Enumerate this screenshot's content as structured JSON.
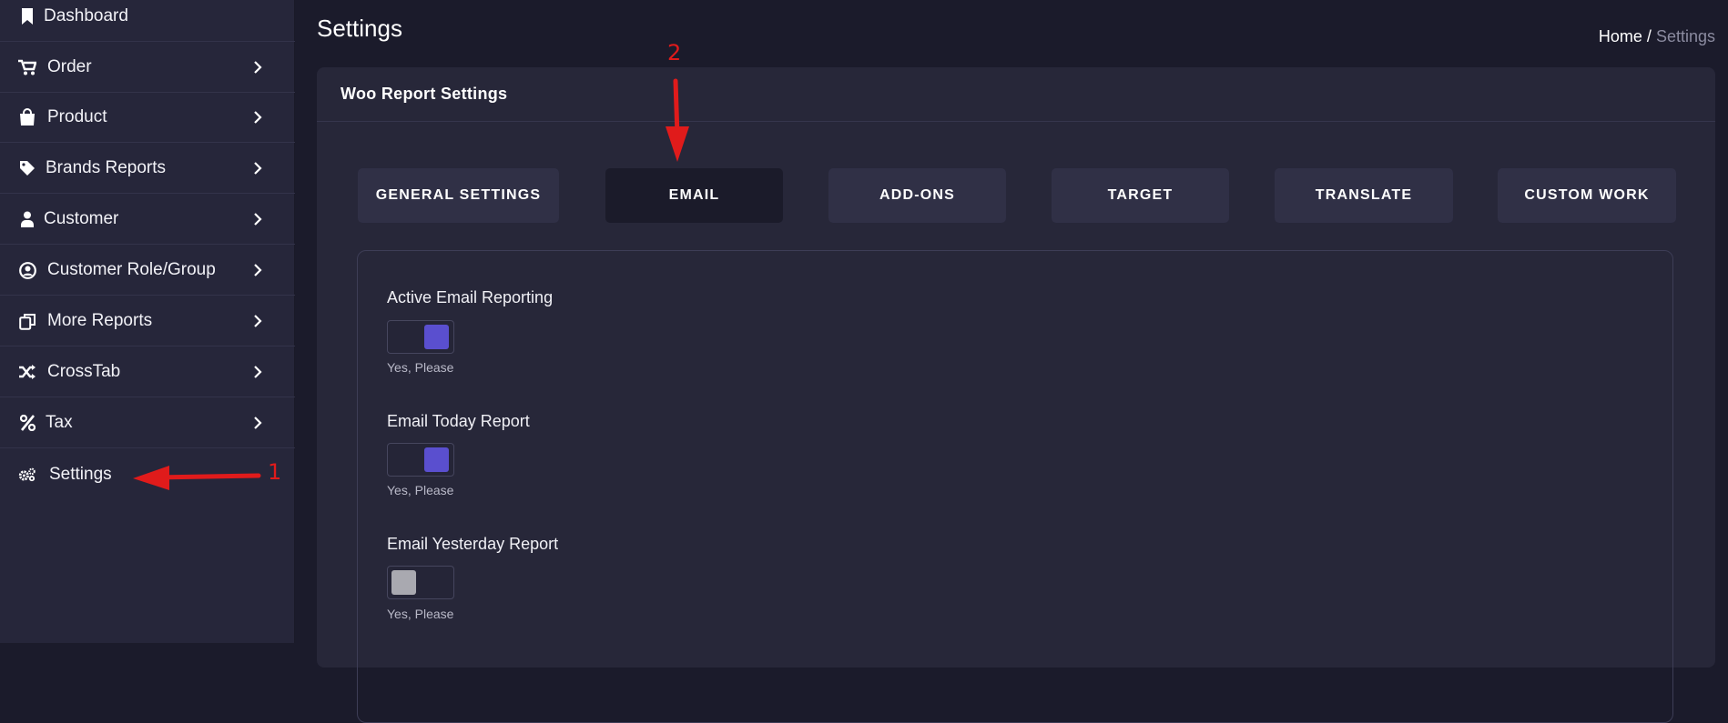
{
  "sidebar": {
    "items": [
      {
        "label": "Dashboard",
        "icon": "bookmark-icon",
        "has_chevron": false
      },
      {
        "label": "Order",
        "icon": "cart-icon",
        "has_chevron": true
      },
      {
        "label": "Product",
        "icon": "shopping-bag-icon",
        "has_chevron": true
      },
      {
        "label": "Brands Reports",
        "icon": "tag-icon",
        "has_chevron": true
      },
      {
        "label": "Customer",
        "icon": "user-icon",
        "has_chevron": true
      },
      {
        "label": "Customer Role/Group",
        "icon": "user-circle-icon",
        "has_chevron": true
      },
      {
        "label": "More Reports",
        "icon": "copy-icon",
        "has_chevron": true
      },
      {
        "label": "CrossTab",
        "icon": "shuffle-icon",
        "has_chevron": true
      },
      {
        "label": "Tax",
        "icon": "percent-icon",
        "has_chevron": true
      },
      {
        "label": "Settings",
        "icon": "gears-icon",
        "has_chevron": false
      }
    ]
  },
  "header": {
    "title": "Settings",
    "breadcrumb": {
      "home": "Home",
      "separator": "/",
      "current": "Settings"
    }
  },
  "card": {
    "title": "Woo Report Settings",
    "tabs": [
      {
        "label": "GENERAL SETTINGS",
        "active": false
      },
      {
        "label": "EMAIL",
        "active": true
      },
      {
        "label": "ADD-ONS",
        "active": false
      },
      {
        "label": "TARGET",
        "active": false
      },
      {
        "label": "TRANSLATE",
        "active": false
      },
      {
        "label": "CUSTOM WORK",
        "active": false
      }
    ]
  },
  "settings": [
    {
      "label": "Active Email Reporting",
      "enabled": true,
      "helper": "Yes, Please"
    },
    {
      "label": "Email Today Report",
      "enabled": true,
      "helper": "Yes, Please"
    },
    {
      "label": "Email Yesterday Report",
      "enabled": false,
      "helper": "Yes, Please"
    }
  ],
  "annotations": {
    "step1": "1",
    "step2": "2"
  },
  "colors": {
    "accent": "#5a4fcf",
    "toggle_off": "#a9a9b0",
    "annotation": "#e01b1b",
    "sidebar_bg": "#26263a",
    "page_bg": "#1b1b2b",
    "card_bg": "#272739"
  }
}
